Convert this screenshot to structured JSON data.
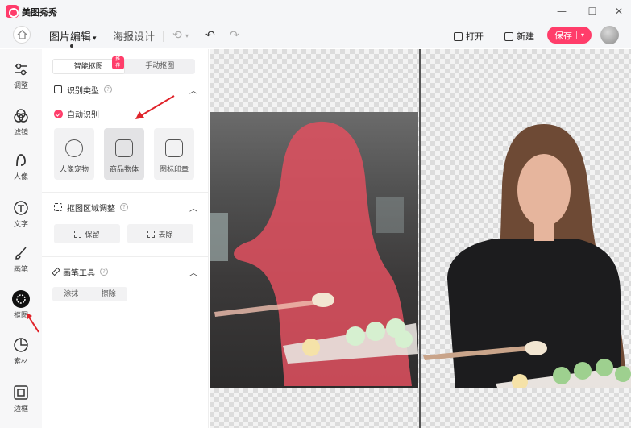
{
  "app": {
    "title": "美图秀秀"
  },
  "toolbar": {
    "tab_main": "图片编辑",
    "tab_poster": "海报设计",
    "open_label": "打开",
    "new_label": "新建",
    "save_label": "保存"
  },
  "rail": {
    "items": [
      {
        "label": "调整",
        "icon": "sliders-icon"
      },
      {
        "label": "滤镜",
        "icon": "filter-icon"
      },
      {
        "label": "人像",
        "icon": "portrait-icon"
      },
      {
        "label": "文字",
        "icon": "text-icon"
      },
      {
        "label": "画笔",
        "icon": "brush-icon"
      },
      {
        "label": "抠图",
        "icon": "cutout-icon"
      },
      {
        "label": "素材",
        "icon": "sticker-icon"
      },
      {
        "label": "边框",
        "icon": "frame-icon"
      }
    ]
  },
  "panel": {
    "mode_smart": "智能抠图",
    "mode_smart_badge": "推荐",
    "mode_manual": "手动抠图",
    "section_type": "识别类型",
    "auto_detect": "自动识别",
    "types": [
      {
        "label": "人像宠物"
      },
      {
        "label": "商品物体"
      },
      {
        "label": "图标印章"
      }
    ],
    "section_adjust": "抠图区域调整",
    "keep_label": "保留",
    "remove_label": "去除",
    "section_pen": "画笔工具",
    "pen_paint": "涂抹",
    "pen_erase": "擦除"
  },
  "colors": {
    "accent": "#ff3d6a",
    "overlay": "#e0505f"
  }
}
